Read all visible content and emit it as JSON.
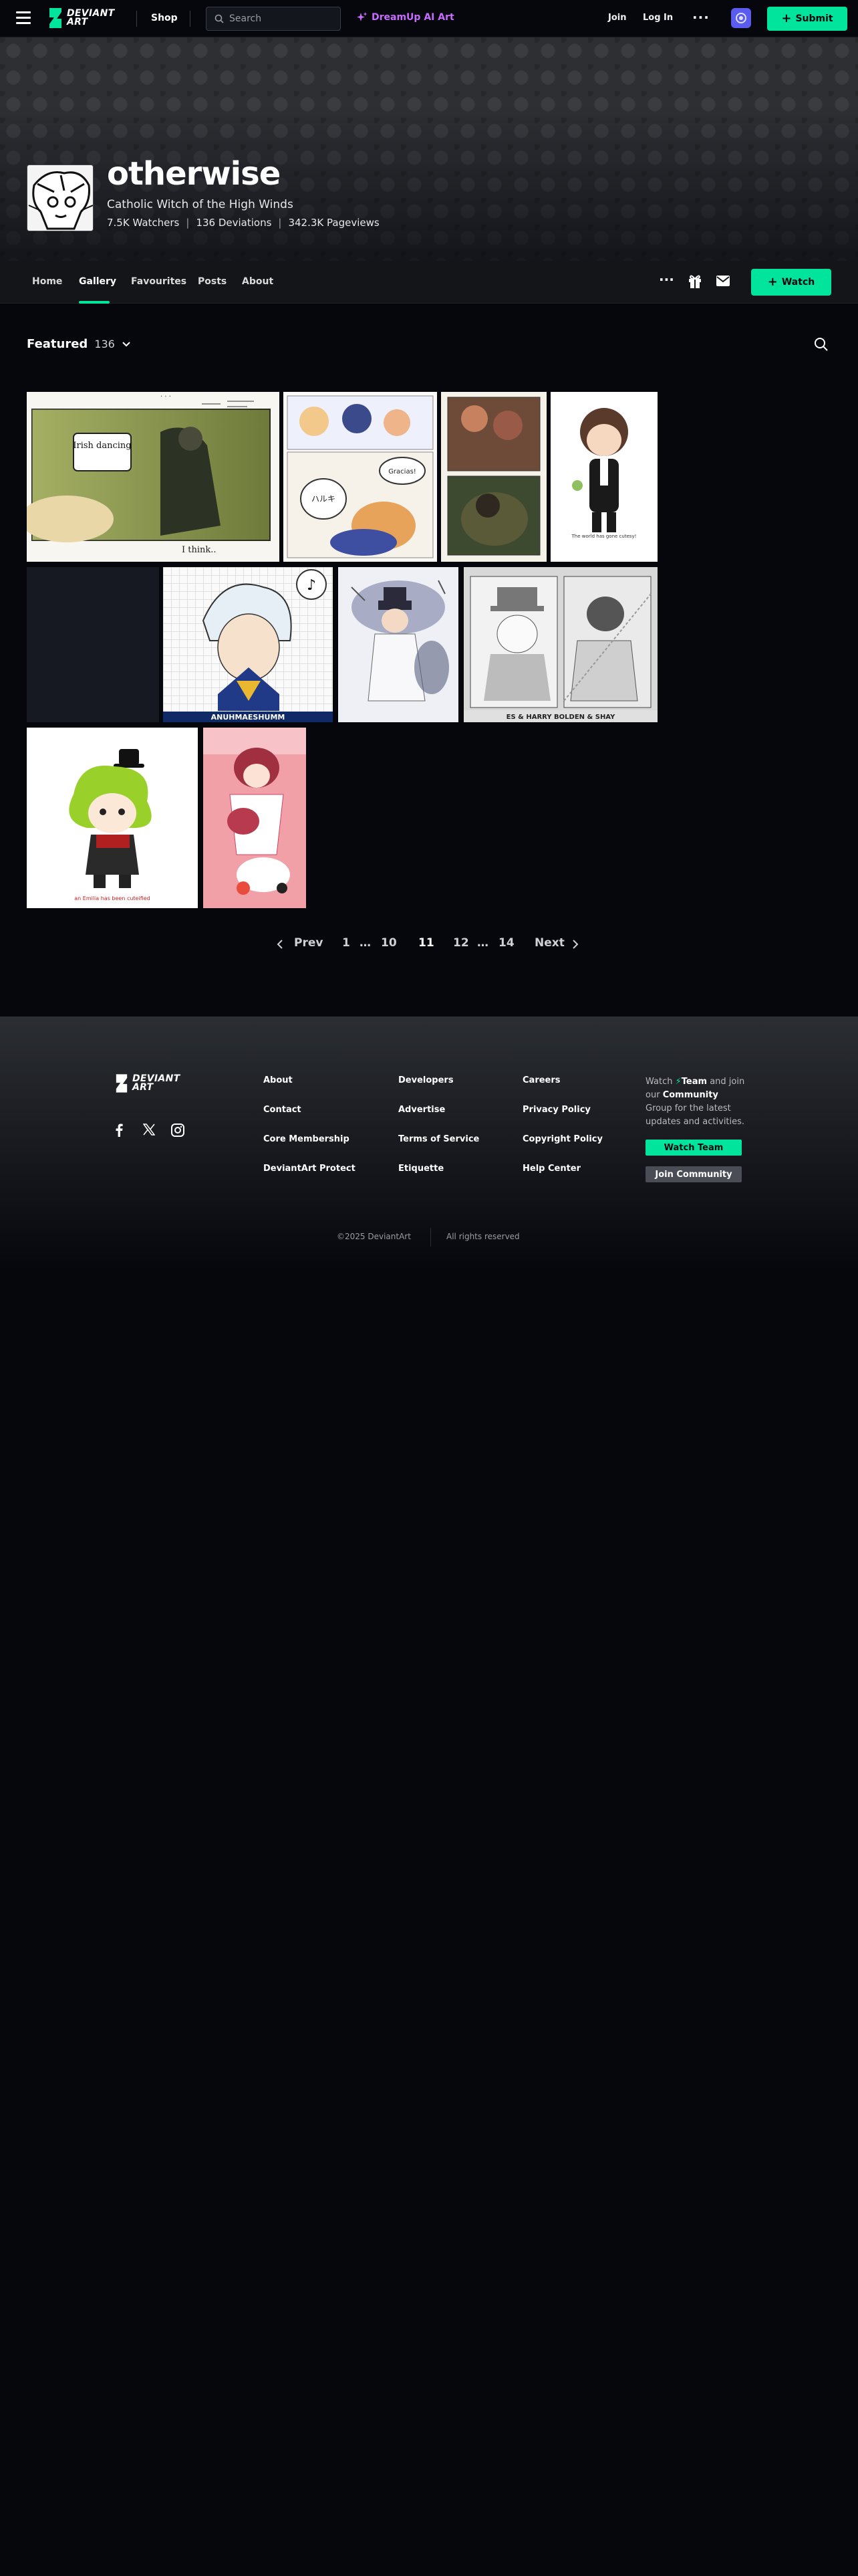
{
  "topbar": {
    "logo_text_1": "DEVIANT",
    "logo_text_2": "ART",
    "shop_label": "Shop",
    "search_placeholder": "Search",
    "dreamup_label": "DreamUp AI Art",
    "join_label": "Join",
    "login_label": "Log In",
    "more_label": "···",
    "submit_label": "Submit",
    "accent_color": "#00e59b",
    "dreamup_color": "#c86bff"
  },
  "profile": {
    "username": "otherwise",
    "tagline": "Catholic Witch of the High Winds",
    "watchers": "7.5K Watchers",
    "deviations": "136 Deviations",
    "pageviews": "342.3K Pageviews",
    "separator": "|"
  },
  "nav": {
    "tabs": [
      {
        "label": "Home"
      },
      {
        "label": "Gallery"
      },
      {
        "label": "Favourites"
      },
      {
        "label": "Posts"
      },
      {
        "label": "About"
      }
    ],
    "active_tab": "Gallery",
    "more_label": "···",
    "watch_label": "Watch"
  },
  "gallery": {
    "folder_title": "Featured",
    "folder_count": "136",
    "thumbnails": [
      {
        "name": "comic-panel-green",
        "caption_1": "Irish dancing",
        "caption_2": "I think.."
      },
      {
        "name": "comic-chibi-sequence",
        "bubble_1": "ハルキ",
        "bubble_2": "Gracias!"
      },
      {
        "name": "two-panel-painting"
      },
      {
        "name": "chibi-suit-boy",
        "caption": "The world has gone cutesy!"
      },
      {
        "name": "dark-placeholder"
      },
      {
        "name": "blue-hair-grid",
        "caption": "ANUHMAESHUMM"
      },
      {
        "name": "watercolor-top-hat"
      },
      {
        "name": "gray-sketch-duo",
        "caption": "ES & HARRY BOLDEN & SHAY"
      },
      {
        "name": "chibi-green-hair",
        "caption": "an Emilia has been cuteified"
      },
      {
        "name": "pink-vertical"
      }
    ]
  },
  "pagination": {
    "prev_label": "Prev",
    "next_label": "Next",
    "pages": [
      "1",
      "…",
      "10",
      "11",
      "12",
      "…",
      "14"
    ],
    "current": "11"
  },
  "footer": {
    "columns": [
      [
        "About",
        "Contact",
        "Core Membership",
        "DeviantArt Protect"
      ],
      [
        "Developers",
        "Advertise",
        "Terms of Service",
        "Etiquette"
      ],
      [
        "Careers",
        "Privacy Policy",
        "Copyright Policy",
        "Help Center"
      ]
    ],
    "promo_watch": "Watch",
    "promo_team": "Team",
    "promo_and": "and join our",
    "promo_community": "Community",
    "promo_rest": "Group for the latest updates and activities.",
    "watch_team_label": "Watch Team",
    "join_community_label": "Join Community",
    "copyright": "©2025 DeviantArt",
    "rights": "All rights reserved"
  }
}
